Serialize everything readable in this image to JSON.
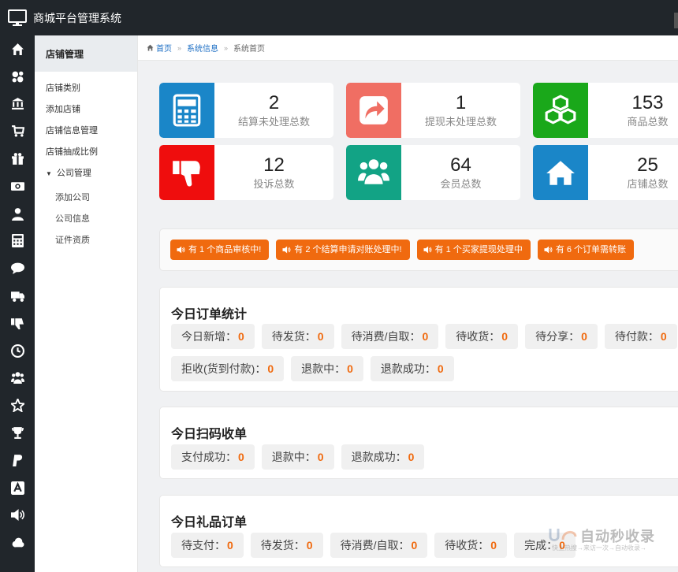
{
  "header": {
    "app_title": "商城平台管理系统",
    "logo_icon": "monitor-icon"
  },
  "rail": {
    "icons": [
      "home-icon",
      "sitemap-icon",
      "bank-icon",
      "cart-icon",
      "gift-icon",
      "money-icon",
      "user-icon",
      "calculator-icon",
      "comment-icon",
      "truck-icon",
      "thumbs-down-icon",
      "clock-icon",
      "users-icon",
      "star-icon",
      "trophy-icon",
      "paypal-icon",
      "amazon-icon",
      "volume-icon",
      "cloud-icon"
    ]
  },
  "submenu": {
    "title": "店铺管理",
    "items": [
      "店铺类别",
      "添加店铺",
      "店铺信息管理",
      "店铺抽成比例"
    ],
    "group": {
      "label": "公司管理",
      "children": [
        "添加公司",
        "公司信息",
        "证件资质"
      ]
    }
  },
  "breadcrumb": {
    "home": "首页",
    "level2": "系统信息",
    "current": "系统首页",
    "separator": "»"
  },
  "stats": [
    {
      "value": "2",
      "label": "结算未处理总数",
      "color": "#1a86c8",
      "icon": "calculator-icon"
    },
    {
      "value": "1",
      "label": "提现未处理总数",
      "color": "#f06e63",
      "icon": "share-icon"
    },
    {
      "value": "153",
      "label": "商品总数",
      "color": "#1aa81a",
      "icon": "cubes-icon"
    },
    {
      "value": "12",
      "label": "投诉总数",
      "color": "#ef0d0d",
      "icon": "thumbs-down-icon"
    },
    {
      "value": "64",
      "label": "会员总数",
      "color": "#12a385",
      "icon": "users-icon"
    },
    {
      "value": "25",
      "label": "店铺总数",
      "color": "#1a86c8",
      "icon": "home-icon"
    }
  ],
  "notices": [
    "有 1 个商品审核中!",
    "有 2 个结算申请对账处理中!",
    "有 1 个买家提现处理中",
    "有 6 个订单需转账"
  ],
  "orders_today": {
    "title": "今日订单统计",
    "row1": [
      {
        "label": "今日新增：",
        "count": "0"
      },
      {
        "label": "待发货：",
        "count": "0"
      },
      {
        "label": "待消费/自取：",
        "count": "0"
      },
      {
        "label": "待收货：",
        "count": "0"
      },
      {
        "label": "待分享：",
        "count": "0"
      },
      {
        "label": "待付款：",
        "count": "0"
      }
    ],
    "row2": [
      {
        "label": "拒收(货到付款)：",
        "count": "0"
      },
      {
        "label": "退款中：",
        "count": "0"
      },
      {
        "label": "退款成功：",
        "count": "0"
      }
    ]
  },
  "scan_today": {
    "title": "今日扫码收单",
    "row1": [
      {
        "label": "支付成功：",
        "count": "0"
      },
      {
        "label": "退款中：",
        "count": "0"
      },
      {
        "label": "退款成功：",
        "count": "0"
      }
    ]
  },
  "gift_today": {
    "title": "今日礼品订单",
    "row1": [
      {
        "label": "待支付：",
        "count": "0"
      },
      {
        "label": "待发货：",
        "count": "0"
      },
      {
        "label": "待消费/自取：",
        "count": "0"
      },
      {
        "label": "待收货：",
        "count": "0"
      },
      {
        "label": "完成：",
        "count": "0"
      }
    ]
  },
  "watermark": {
    "main": "自动秒收录",
    "sub": "快上热搜→来访一次→自动收录→"
  }
}
